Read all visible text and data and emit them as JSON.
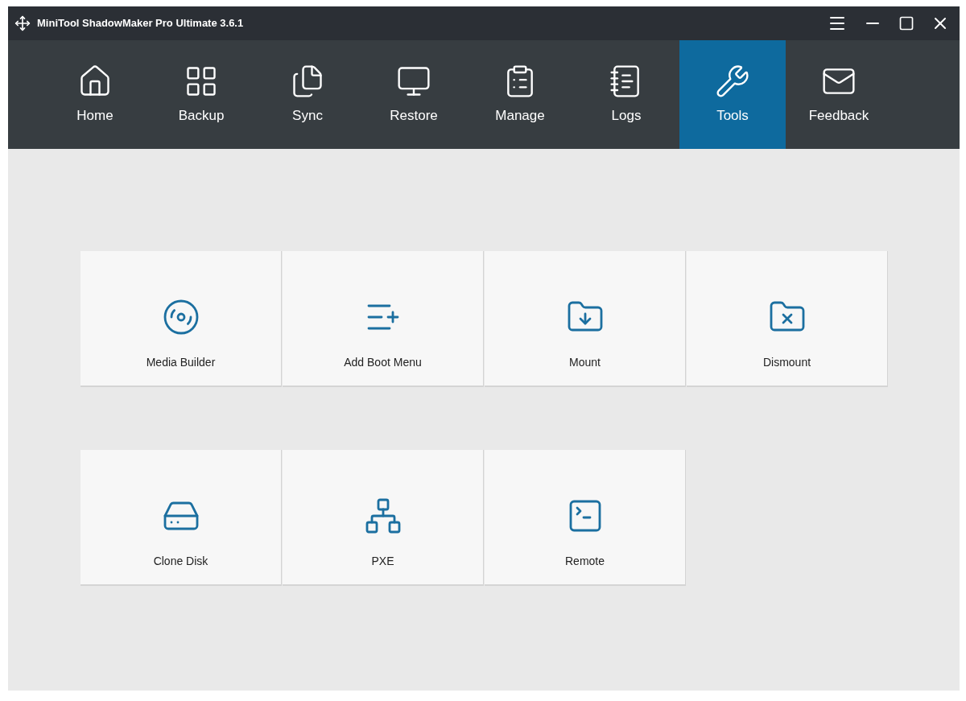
{
  "window": {
    "title": "MiniTool ShadowMaker Pro Ultimate 3.6.1"
  },
  "nav": [
    {
      "label": "Home",
      "selected": false
    },
    {
      "label": "Backup",
      "selected": false
    },
    {
      "label": "Sync",
      "selected": false
    },
    {
      "label": "Restore",
      "selected": false
    },
    {
      "label": "Manage",
      "selected": false
    },
    {
      "label": "Logs",
      "selected": false
    },
    {
      "label": "Tools",
      "selected": true
    },
    {
      "label": "Feedback",
      "selected": false
    }
  ],
  "tools": [
    {
      "label": "Media Builder"
    },
    {
      "label": "Add Boot Menu"
    },
    {
      "label": "Mount"
    },
    {
      "label": "Dismount"
    },
    {
      "label": "Clone Disk"
    },
    {
      "label": "PXE"
    },
    {
      "label": "Remote"
    }
  ]
}
